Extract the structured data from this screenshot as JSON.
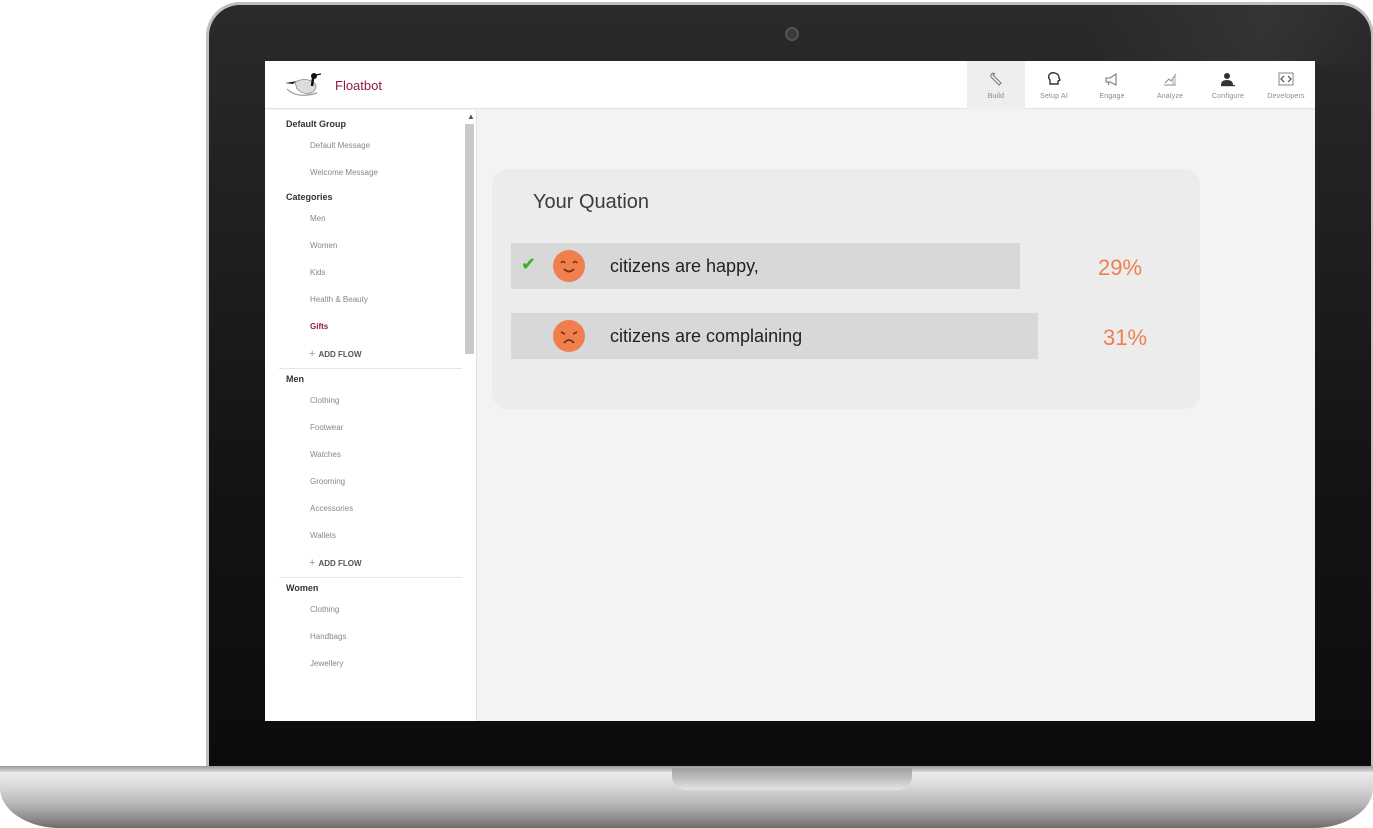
{
  "app": {
    "brand": "Floatbot"
  },
  "nav": [
    {
      "label": "Build",
      "icon": "wrench-icon",
      "active": true
    },
    {
      "label": "Setup AI",
      "icon": "brain-icon"
    },
    {
      "label": "Engage",
      "icon": "megaphone-icon"
    },
    {
      "label": "Analyze",
      "icon": "chart-icon"
    },
    {
      "label": "Configure",
      "icon": "user-settings-icon"
    },
    {
      "label": "Developers",
      "icon": "code-icon"
    }
  ],
  "sidebar": {
    "default_group": {
      "title": "Default Group",
      "items": [
        "Default Message",
        "Welcome Message"
      ]
    },
    "categories": {
      "title": "Categories",
      "items": [
        "Men",
        "Women",
        "Kids",
        "Health & Beauty",
        "Gifts"
      ],
      "active": "Gifts",
      "add_flow": "ADD FLOW"
    },
    "men": {
      "title": "Men",
      "items": [
        "Clothing",
        "Footwear",
        "Watches",
        "Grooming",
        "Accessories",
        "Wallets"
      ],
      "add_flow": "ADD FLOW"
    },
    "women": {
      "title": "Women",
      "items": [
        "Clothing",
        "Handbags",
        "Jewellery"
      ]
    }
  },
  "poll": {
    "question": "Your Quation",
    "options": [
      {
        "text": "citizens are happy,",
        "percent": "29%",
        "selected": true,
        "face": "happy-face-icon"
      },
      {
        "text": "citizens are complaining",
        "percent": "31%",
        "selected": false,
        "face": "sad-face-icon"
      }
    ]
  },
  "colors": {
    "brand": "#8a1f3a",
    "accent": "#f07f4d",
    "check": "#38b11f"
  }
}
